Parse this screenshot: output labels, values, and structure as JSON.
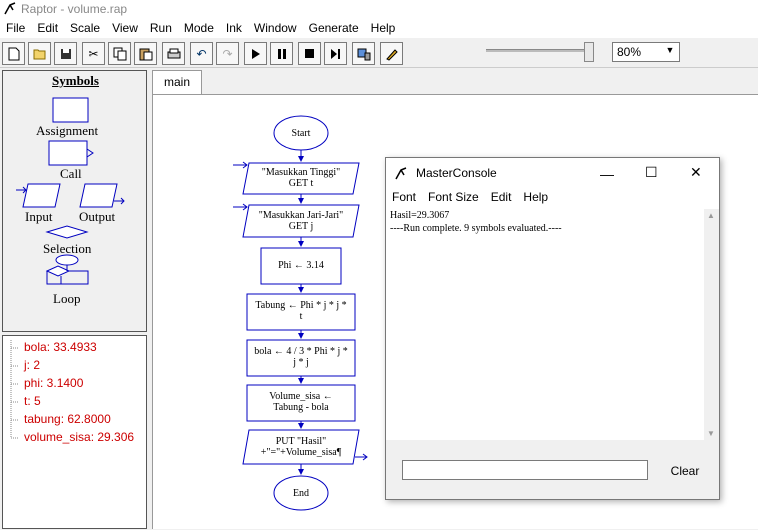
{
  "window": {
    "title": "Raptor - volume.rap"
  },
  "menu": [
    "File",
    "Edit",
    "Scale",
    "View",
    "Run",
    "Mode",
    "Ink",
    "Window",
    "Generate",
    "Help"
  ],
  "toolbar": {
    "zoom": "80%"
  },
  "symbols": {
    "title": "Symbols",
    "assignment": "Assignment",
    "call": "Call",
    "input": "Input",
    "output": "Output",
    "selection": "Selection",
    "loop": "Loop"
  },
  "variables": [
    "bola: 33.4933",
    "j: 2",
    "phi: 3.1400",
    "t: 5",
    "tabung: 62.8000",
    "volume_sisa: 29.306"
  ],
  "tab": "main",
  "flowchart": {
    "start": "Start",
    "input1_l1": "\"Masukkan Tinggi\"",
    "input1_l2": "GET t",
    "input2_l1": "\"Masukkan Jari-Jari\"",
    "input2_l2": "GET j",
    "assign1": "Phi ← 3.14",
    "assign2_l1": "Tabung ← Phi * j * j *",
    "assign2_l2": "t",
    "assign3_l1": "bola ← 4 / 3 * Phi * j *",
    "assign3_l2": "j * j",
    "assign4_l1": "Volume_sisa ←",
    "assign4_l2": "Tabung - bola",
    "output_l1": "PUT \"Hasil\"",
    "output_l2": "+\"=\"+Volume_sisa¶",
    "end": "End"
  },
  "console": {
    "title": "MasterConsole",
    "menu": [
      "Font",
      "Font Size",
      "Edit",
      "Help"
    ],
    "line1": "Hasil=29.3067",
    "line2": "----Run complete.  9 symbols evaluated.----",
    "clear": "Clear"
  }
}
